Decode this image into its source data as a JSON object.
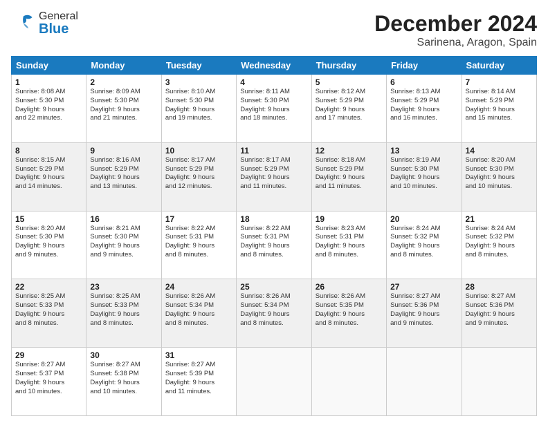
{
  "header": {
    "logo_general": "General",
    "logo_blue": "Blue",
    "month_title": "December 2024",
    "location": "Sarinena, Aragon, Spain"
  },
  "calendar": {
    "headers": [
      "Sunday",
      "Monday",
      "Tuesday",
      "Wednesday",
      "Thursday",
      "Friday",
      "Saturday"
    ],
    "rows": [
      [
        {
          "day": "1",
          "info": "Sunrise: 8:08 AM\nSunset: 5:30 PM\nDaylight: 9 hours\nand 22 minutes."
        },
        {
          "day": "2",
          "info": "Sunrise: 8:09 AM\nSunset: 5:30 PM\nDaylight: 9 hours\nand 21 minutes."
        },
        {
          "day": "3",
          "info": "Sunrise: 8:10 AM\nSunset: 5:30 PM\nDaylight: 9 hours\nand 19 minutes."
        },
        {
          "day": "4",
          "info": "Sunrise: 8:11 AM\nSunset: 5:30 PM\nDaylight: 9 hours\nand 18 minutes."
        },
        {
          "day": "5",
          "info": "Sunrise: 8:12 AM\nSunset: 5:29 PM\nDaylight: 9 hours\nand 17 minutes."
        },
        {
          "day": "6",
          "info": "Sunrise: 8:13 AM\nSunset: 5:29 PM\nDaylight: 9 hours\nand 16 minutes."
        },
        {
          "day": "7",
          "info": "Sunrise: 8:14 AM\nSunset: 5:29 PM\nDaylight: 9 hours\nand 15 minutes."
        }
      ],
      [
        {
          "day": "8",
          "info": "Sunrise: 8:15 AM\nSunset: 5:29 PM\nDaylight: 9 hours\nand 14 minutes."
        },
        {
          "day": "9",
          "info": "Sunrise: 8:16 AM\nSunset: 5:29 PM\nDaylight: 9 hours\nand 13 minutes."
        },
        {
          "day": "10",
          "info": "Sunrise: 8:17 AM\nSunset: 5:29 PM\nDaylight: 9 hours\nand 12 minutes."
        },
        {
          "day": "11",
          "info": "Sunrise: 8:17 AM\nSunset: 5:29 PM\nDaylight: 9 hours\nand 11 minutes."
        },
        {
          "day": "12",
          "info": "Sunrise: 8:18 AM\nSunset: 5:29 PM\nDaylight: 9 hours\nand 11 minutes."
        },
        {
          "day": "13",
          "info": "Sunrise: 8:19 AM\nSunset: 5:30 PM\nDaylight: 9 hours\nand 10 minutes."
        },
        {
          "day": "14",
          "info": "Sunrise: 8:20 AM\nSunset: 5:30 PM\nDaylight: 9 hours\nand 10 minutes."
        }
      ],
      [
        {
          "day": "15",
          "info": "Sunrise: 8:20 AM\nSunset: 5:30 PM\nDaylight: 9 hours\nand 9 minutes."
        },
        {
          "day": "16",
          "info": "Sunrise: 8:21 AM\nSunset: 5:30 PM\nDaylight: 9 hours\nand 9 minutes."
        },
        {
          "day": "17",
          "info": "Sunrise: 8:22 AM\nSunset: 5:31 PM\nDaylight: 9 hours\nand 8 minutes."
        },
        {
          "day": "18",
          "info": "Sunrise: 8:22 AM\nSunset: 5:31 PM\nDaylight: 9 hours\nand 8 minutes."
        },
        {
          "day": "19",
          "info": "Sunrise: 8:23 AM\nSunset: 5:31 PM\nDaylight: 9 hours\nand 8 minutes."
        },
        {
          "day": "20",
          "info": "Sunrise: 8:24 AM\nSunset: 5:32 PM\nDaylight: 9 hours\nand 8 minutes."
        },
        {
          "day": "21",
          "info": "Sunrise: 8:24 AM\nSunset: 5:32 PM\nDaylight: 9 hours\nand 8 minutes."
        }
      ],
      [
        {
          "day": "22",
          "info": "Sunrise: 8:25 AM\nSunset: 5:33 PM\nDaylight: 9 hours\nand 8 minutes."
        },
        {
          "day": "23",
          "info": "Sunrise: 8:25 AM\nSunset: 5:33 PM\nDaylight: 9 hours\nand 8 minutes."
        },
        {
          "day": "24",
          "info": "Sunrise: 8:26 AM\nSunset: 5:34 PM\nDaylight: 9 hours\nand 8 minutes."
        },
        {
          "day": "25",
          "info": "Sunrise: 8:26 AM\nSunset: 5:34 PM\nDaylight: 9 hours\nand 8 minutes."
        },
        {
          "day": "26",
          "info": "Sunrise: 8:26 AM\nSunset: 5:35 PM\nDaylight: 9 hours\nand 8 minutes."
        },
        {
          "day": "27",
          "info": "Sunrise: 8:27 AM\nSunset: 5:36 PM\nDaylight: 9 hours\nand 9 minutes."
        },
        {
          "day": "28",
          "info": "Sunrise: 8:27 AM\nSunset: 5:36 PM\nDaylight: 9 hours\nand 9 minutes."
        }
      ],
      [
        {
          "day": "29",
          "info": "Sunrise: 8:27 AM\nSunset: 5:37 PM\nDaylight: 9 hours\nand 10 minutes."
        },
        {
          "day": "30",
          "info": "Sunrise: 8:27 AM\nSunset: 5:38 PM\nDaylight: 9 hours\nand 10 minutes."
        },
        {
          "day": "31",
          "info": "Sunrise: 8:27 AM\nSunset: 5:39 PM\nDaylight: 9 hours\nand 11 minutes."
        },
        {
          "day": "",
          "info": ""
        },
        {
          "day": "",
          "info": ""
        },
        {
          "day": "",
          "info": ""
        },
        {
          "day": "",
          "info": ""
        }
      ]
    ]
  }
}
